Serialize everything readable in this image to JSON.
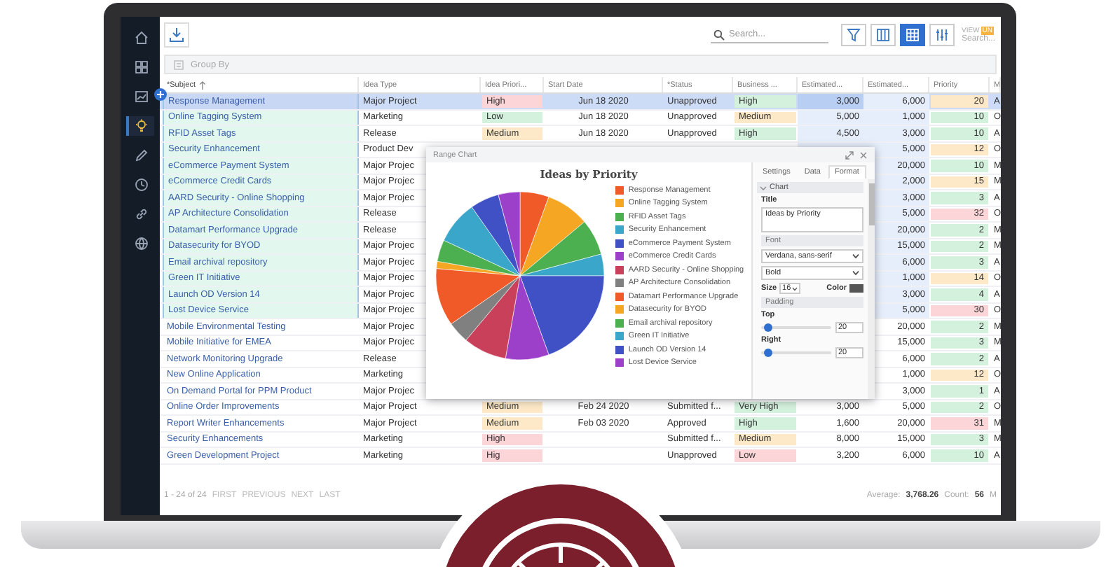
{
  "sidebar": {
    "items": [
      {
        "kind": "home",
        "selected": false
      },
      {
        "kind": "dashboard",
        "selected": false
      },
      {
        "kind": "report",
        "selected": false
      },
      {
        "kind": "idea",
        "selected": true
      },
      {
        "kind": "pencil",
        "selected": false
      },
      {
        "kind": "clock",
        "selected": false
      },
      {
        "kind": "link",
        "selected": false
      },
      {
        "kind": "globe",
        "selected": false
      }
    ]
  },
  "toolbar": {
    "search": {
      "placeholder": "Search..."
    },
    "view_buttons": [
      {
        "kind": "filter",
        "selected": false
      },
      {
        "kind": "columns",
        "selected": false
      },
      {
        "kind": "grid",
        "selected": true
      },
      {
        "kind": "settings",
        "selected": false
      }
    ],
    "view_label": "VIEW",
    "view_tag": "UN",
    "view_search": {
      "placeholder": "Search..."
    }
  },
  "group_by": "Group By",
  "table": {
    "columns": [
      {
        "label": "*Subject",
        "sorted": true
      },
      {
        "label": "Idea Type",
        "sorted": false
      },
      {
        "label": "Idea Priori...",
        "sorted": false
      },
      {
        "label": "Start Date",
        "sorted": false
      },
      {
        "label": "*Status",
        "sorted": false
      },
      {
        "label": "Business ...",
        "sorted": false
      },
      {
        "label": "Estimated...",
        "sorted": false
      },
      {
        "label": "Estimated...",
        "sorted": false
      },
      {
        "label": "Priority",
        "sorted": false
      },
      {
        "label": "M",
        "sorted": false
      }
    ],
    "rows": [
      {
        "selected": true,
        "active": true,
        "cells": [
          "Response Management",
          "Major Project",
          {
            "text": "High",
            "color": "#fcd5d8"
          },
          "Jun 18 2020",
          "Unapproved",
          {
            "text": "High",
            "color": "#d3f1dd"
          },
          "3,000",
          "6,000",
          {
            "text": "20",
            "color": "#fde9c8"
          },
          "A"
        ]
      },
      {
        "selected": true,
        "active": false,
        "cells": [
          "Online Tagging System",
          "Marketing",
          {
            "text": "Low",
            "color": "#d3f1dd"
          },
          "Jun 18 2020",
          "Unapproved",
          {
            "text": "Medium",
            "color": "#fde9c8"
          },
          "5,000",
          "1,000",
          {
            "text": "10",
            "color": "#d3f1dd"
          },
          "O"
        ]
      },
      {
        "selected": true,
        "active": false,
        "cells": [
          "RFID Asset Tags",
          "Release",
          {
            "text": "Medium",
            "color": "#fde9c8"
          },
          "Jun 18 2020",
          "Unapproved",
          {
            "text": "High",
            "color": "#d3f1dd"
          },
          "4,500",
          "3,000",
          {
            "text": "10",
            "color": "#d3f1dd"
          },
          "A"
        ]
      },
      {
        "selected": true,
        "active": false,
        "cells": [
          "Security Enhancement",
          "Product Dev",
          null,
          null,
          null,
          null,
          null,
          "5,000",
          {
            "text": "12",
            "color": "#fde9c8"
          },
          "O"
        ]
      },
      {
        "selected": true,
        "active": false,
        "cells": [
          "eCommerce Payment System",
          "Major Projec",
          null,
          null,
          null,
          null,
          null,
          "20,000",
          {
            "text": "10",
            "color": "#d3f1dd"
          },
          "M"
        ]
      },
      {
        "selected": true,
        "active": false,
        "cells": [
          "eCommerce Credit Cards",
          "Major Projec",
          null,
          null,
          null,
          null,
          null,
          "2,000",
          {
            "text": "15",
            "color": "#fde9c8"
          },
          "M"
        ]
      },
      {
        "selected": true,
        "active": false,
        "cells": [
          "AARD Security - Online Shopping",
          "Major Projec",
          null,
          null,
          null,
          null,
          null,
          "3,000",
          {
            "text": "3",
            "color": "#d3f1dd"
          },
          "A"
        ]
      },
      {
        "selected": true,
        "active": false,
        "cells": [
          "AP Architecture Consolidation",
          "Release",
          null,
          null,
          null,
          null,
          null,
          "5,000",
          {
            "text": "32",
            "color": "#fcd5d8"
          },
          "O"
        ]
      },
      {
        "selected": true,
        "active": false,
        "cells": [
          "Datamart Performance Upgrade",
          "Release",
          null,
          null,
          null,
          null,
          null,
          "20,000",
          {
            "text": "2",
            "color": "#d3f1dd"
          },
          "M"
        ]
      },
      {
        "selected": true,
        "active": false,
        "cells": [
          "Datasecurity for BYOD",
          "Major Projec",
          null,
          null,
          null,
          null,
          null,
          "15,000",
          {
            "text": "2",
            "color": "#d3f1dd"
          },
          "M"
        ]
      },
      {
        "selected": true,
        "active": false,
        "cells": [
          "Email archival repository",
          "Major Projec",
          null,
          null,
          null,
          null,
          null,
          "6,000",
          {
            "text": "3",
            "color": "#d3f1dd"
          },
          "A"
        ]
      },
      {
        "selected": true,
        "active": false,
        "cells": [
          "Green IT Initiative",
          "Major Projec",
          null,
          null,
          null,
          null,
          null,
          "1,000",
          {
            "text": "14",
            "color": "#fde9c8"
          },
          "O"
        ]
      },
      {
        "selected": true,
        "active": false,
        "cells": [
          "Launch OD Version 14",
          "Major Projec",
          null,
          null,
          null,
          null,
          null,
          "3,000",
          {
            "text": "4",
            "color": "#d3f1dd"
          },
          "A"
        ]
      },
      {
        "selected": true,
        "active": false,
        "cells": [
          "Lost Device Service",
          "Major Projec",
          null,
          null,
          null,
          null,
          null,
          "5,000",
          {
            "text": "30",
            "color": "#fcd5d8"
          },
          "O"
        ]
      },
      {
        "selected": false,
        "active": false,
        "cells": [
          "Mobile Environmental Testing",
          "Major Projec",
          null,
          null,
          null,
          null,
          null,
          "20,000",
          {
            "text": "2",
            "color": "#d3f1dd"
          },
          "M"
        ]
      },
      {
        "selected": false,
        "active": false,
        "cells": [
          "Mobile Initiative for EMEA",
          "Major Projec",
          null,
          null,
          null,
          null,
          null,
          "15,000",
          {
            "text": "3",
            "color": "#d3f1dd"
          },
          "M"
        ]
      },
      {
        "selected": false,
        "active": false,
        "cells": [
          "Network Monitoring Upgrade",
          "Release",
          null,
          null,
          null,
          null,
          null,
          "6,000",
          {
            "text": "2",
            "color": "#d3f1dd"
          },
          "A"
        ]
      },
      {
        "selected": false,
        "active": false,
        "cells": [
          "New Online Application",
          "Marketing",
          null,
          null,
          null,
          null,
          null,
          "1,000",
          {
            "text": "12",
            "color": "#fde9c8"
          },
          "O"
        ]
      },
      {
        "selected": false,
        "active": false,
        "cells": [
          "On Demand Portal for PPM Product",
          "Major Projec",
          null,
          null,
          null,
          null,
          null,
          "3,000",
          {
            "text": "1",
            "color": "#d3f1dd"
          },
          "A"
        ]
      },
      {
        "selected": false,
        "active": false,
        "cells": [
          "Online Order Improvements",
          "Major Project",
          {
            "text": "Medium",
            "color": "#fde9c8"
          },
          "Feb 24 2020",
          "Submitted f...",
          {
            "text": "Very High",
            "color": "#d3f1dd"
          },
          "3,000",
          "5,000",
          {
            "text": "2",
            "color": "#d3f1dd"
          },
          "O"
        ]
      },
      {
        "selected": false,
        "active": false,
        "cells": [
          "Report Writer Enhancements",
          "Major Project",
          {
            "text": "Medium",
            "color": "#fde9c8"
          },
          "Feb 03 2020",
          "Approved",
          {
            "text": "High",
            "color": "#d3f1dd"
          },
          "1,600",
          "20,000",
          {
            "text": "31",
            "color": "#fcd5d8"
          },
          "M"
        ]
      },
      {
        "selected": false,
        "active": false,
        "cells": [
          "Security Enhancements",
          "Marketing",
          {
            "text": "High",
            "color": "#fcd5d8"
          },
          null,
          "Submitted f...",
          {
            "text": "Medium",
            "color": "#fde9c8"
          },
          "8,000",
          "15,000",
          {
            "text": "3",
            "color": "#d3f1dd"
          },
          "M"
        ]
      },
      {
        "selected": false,
        "active": false,
        "cells": [
          "Green Development Project",
          "Marketing",
          {
            "text": "Hig",
            "color": "#fcd5d8"
          },
          null,
          "Unapproved",
          {
            "text": "Low",
            "color": "#fcd5d8"
          },
          "3,200",
          "6,000",
          {
            "text": "10",
            "color": "#d3f1dd"
          },
          "A"
        ]
      }
    ]
  },
  "footer": {
    "pager": "1 - 24 of 24",
    "links": [
      "FIRST",
      "PREVIOUS",
      "NEXT",
      "LAST"
    ],
    "summary": [
      {
        "label": "Average:",
        "value": "3,768.26"
      },
      {
        "label": "Count:",
        "value": "56"
      },
      {
        "label": "M"
      }
    ]
  },
  "dialog": {
    "title": "Range Chart",
    "chart": {
      "title": "Ideas by Priority",
      "legend": [
        {
          "label": "Response Management",
          "color": "#f05a28"
        },
        {
          "label": "Online Tagging System",
          "color": "#f5a623"
        },
        {
          "label": "RFID Asset Tags",
          "color": "#4caf50"
        },
        {
          "label": "Security Enhancement",
          "color": "#3aa6c9"
        },
        {
          "label": "eCommerce Payment System",
          "color": "#3f51c5"
        },
        {
          "label": "eCommerce Credit Cards",
          "color": "#9c3fc9"
        },
        {
          "label": "AARD Security - Online Shopping",
          "color": "#c9405a"
        },
        {
          "label": "AP Architecture Consolidation",
          "color": "#808080"
        },
        {
          "label": "Datamart Performance Upgrade",
          "color": "#f05a28"
        },
        {
          "label": "Datasecurity for BYOD",
          "color": "#f5a623"
        },
        {
          "label": "Email archival repository",
          "color": "#4caf50"
        },
        {
          "label": "Green IT Initiative",
          "color": "#3aa6c9"
        },
        {
          "label": "Launch OD Version 14",
          "color": "#3f51c5"
        },
        {
          "label": "Lost Device Service",
          "color": "#9c3fc9"
        }
      ]
    },
    "panel": {
      "tabs": [
        {
          "label": "Settings",
          "selected": false
        },
        {
          "label": "Data",
          "selected": false
        },
        {
          "label": "Format",
          "selected": true
        }
      ],
      "section": {
        "label": "Chart",
        "expanded": true
      },
      "title_label": "Title",
      "title_value": "Ideas by Priority",
      "font_label": "Font",
      "font_family": "Verdana, sans-serif",
      "font_weight": "Bold",
      "size_label": "Size",
      "size_value": "16",
      "color_label": "Color",
      "padding_label": "Padding",
      "paddings": [
        {
          "label": "Top",
          "level": 0.1,
          "value": "20"
        },
        {
          "label": "Right",
          "level": 0.1,
          "value": "20"
        }
      ]
    }
  }
}
